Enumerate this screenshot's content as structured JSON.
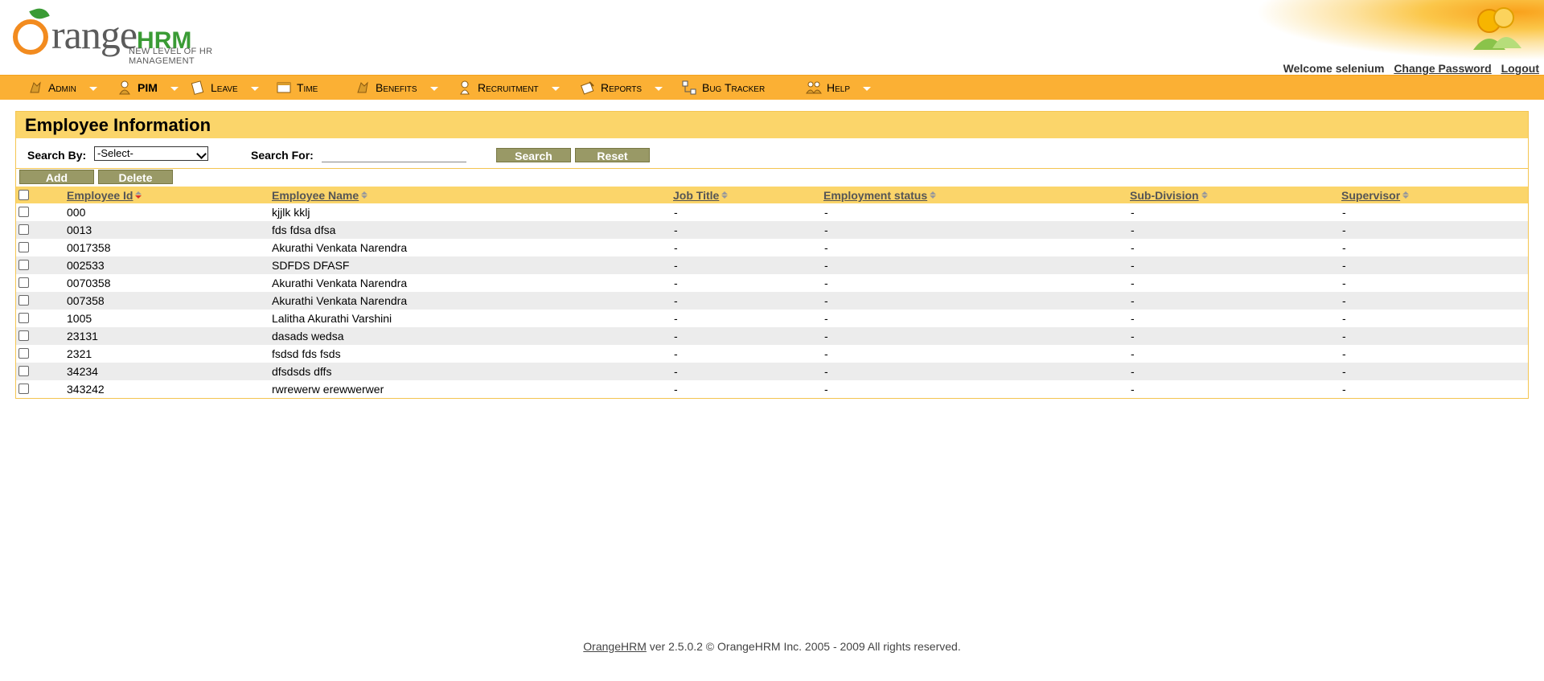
{
  "logo": {
    "word": "range",
    "hrm": "HRM",
    "tagline": "NEW LEVEL OF HR MANAGEMENT"
  },
  "header": {
    "welcome": "Welcome selenium",
    "change_password": "Change Password",
    "logout": "Logout"
  },
  "menu": [
    {
      "label": "Admin",
      "icon": "admin-icon"
    },
    {
      "label": "PIM",
      "icon": "pim-icon"
    },
    {
      "label": "Leave",
      "icon": "leave-icon"
    },
    {
      "label": "Time",
      "icon": "time-icon"
    },
    {
      "label": "Benefits",
      "icon": "benefits-icon"
    },
    {
      "label": "Recruitment",
      "icon": "recruitment-icon"
    },
    {
      "label": "Reports",
      "icon": "reports-icon"
    },
    {
      "label": "Bug Tracker",
      "icon": "bug-tracker-icon"
    },
    {
      "label": "Help",
      "icon": "help-icon"
    }
  ],
  "panel": {
    "title": "Employee Information",
    "search_by_label": "Search By:",
    "search_by_value": "-Select-",
    "search_for_label": "Search For:",
    "search_for_value": "",
    "search_button": "Search",
    "reset_button": "Reset",
    "add_button": "Add",
    "delete_button": "Delete"
  },
  "table": {
    "columns": [
      "Employee Id",
      "Employee Name",
      "Job Title",
      "Employment status",
      "Sub-Division",
      "Supervisor"
    ],
    "sorted_column": "Employee Id",
    "rows": [
      [
        "000",
        "kjjlk kklj",
        "-",
        "-",
        "-",
        "-"
      ],
      [
        "0013",
        "fds fdsa dfsa",
        "-",
        "-",
        "-",
        "-"
      ],
      [
        "0017358",
        "Akurathi Venkata Narendra",
        "-",
        "-",
        "-",
        "-"
      ],
      [
        "002533",
        "SDFDS DFASF",
        "-",
        "-",
        "-",
        "-"
      ],
      [
        "0070358",
        "Akurathi Venkata Narendra",
        "-",
        "-",
        "-",
        "-"
      ],
      [
        "007358",
        "Akurathi Venkata Narendra",
        "-",
        "-",
        "-",
        "-"
      ],
      [
        "1005",
        "Lalitha Akurathi Varshini",
        "-",
        "-",
        "-",
        "-"
      ],
      [
        "23131",
        "dasads wedsa",
        "-",
        "-",
        "-",
        "-"
      ],
      [
        "2321",
        "fsdsd fds fsds",
        "-",
        "-",
        "-",
        "-"
      ],
      [
        "34234",
        "dfsdsds dffs",
        "-",
        "-",
        "-",
        "-"
      ],
      [
        "343242",
        "rwrewerw erewwerwer",
        "-",
        "-",
        "-",
        "-"
      ]
    ]
  },
  "footer": {
    "link": "OrangeHRM",
    "text": " ver 2.5.0.2 © OrangeHRM Inc. 2005 - 2009 All rights reserved."
  },
  "colors": {
    "menu_bg": "#fbb034",
    "panel_header": "#fbd56a",
    "button": "#999966"
  }
}
